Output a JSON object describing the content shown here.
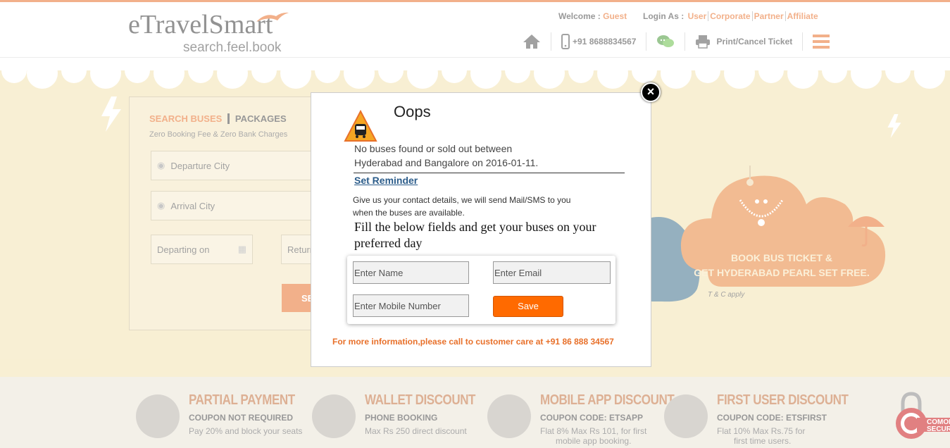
{
  "header": {
    "logo_main": "eTravelSmart",
    "logo_tagline": "search.feel.book",
    "welcome_label": "Welcome :",
    "welcome_user": "Guest",
    "login_label": "Login As :",
    "login_options": [
      "User",
      "Corporate",
      "Partner",
      "Affiliate"
    ],
    "phone": "+91 8688834567",
    "print_cancel": "Print/Cancel Ticket",
    "icons": [
      "home-icon",
      "mobile-icon",
      "chat-icon",
      "printer-icon",
      "menu-icon"
    ]
  },
  "search": {
    "tab_buses": "SEARCH BUSES",
    "tab_packages": "PACKAGES",
    "note": "Zero Booking Fee & Zero Bank Charges",
    "departure_placeholder": "Departure City",
    "arrival_placeholder": "Arrival City",
    "departing_placeholder": "Departing on",
    "return_placeholder": "Return",
    "search_label": "SE"
  },
  "promo": {
    "line1": "BOOK BUS TICKET &",
    "line2": "GET HYDERABAD PEARL SET FREE.",
    "tc": "T & C apply"
  },
  "offers": [
    {
      "title": "PARTIAL PAYMENT",
      "code": "COUPON NOT REQUIRED",
      "desc1": "Pay 20% and block your seats",
      "desc2": ""
    },
    {
      "title": "WALLET DISCOUNT",
      "code": "PHONE BOOKING",
      "desc1": "Max Rs 250 direct discount",
      "desc2": ""
    },
    {
      "title": "MOBILE APP DISCOUNT",
      "code": "COUPON CODE: ETSAPP",
      "desc1": "Flat 8% Max Rs 101, for first",
      "desc2": "mobile app booking."
    },
    {
      "title": "FIRST USER DISCOUNT",
      "code": "COUPON CODE: ETSFIRST",
      "desc1": "Flat 10% Max Rs.75 for",
      "desc2": "first time users."
    }
  ],
  "security_badge": "COMODO SECURE",
  "modal": {
    "title": "Oops",
    "message_line1": "No buses found or sold out between",
    "message_line2": "Hyderabad and Bangalore on 2016-01-11.",
    "set_reminder": "Set Reminder",
    "give_line1": "Give us your contact details, we will send Mail/SMS to you",
    "give_line2": "when the buses are available.",
    "fill_text": "Fill the below fields and get your buses on your preferred day",
    "name_placeholder": "Enter Name",
    "email_placeholder": "Enter Email",
    "mobile_placeholder": "Enter Mobile Number",
    "save_label": "Save",
    "info": "For more information,please call to customer care at +91 86 888 34567",
    "close_symbol": "×"
  },
  "colors": {
    "brand_orange": "#e8702a",
    "save_orange": "#ff6a00",
    "link_blue": "#2b5c8a"
  }
}
